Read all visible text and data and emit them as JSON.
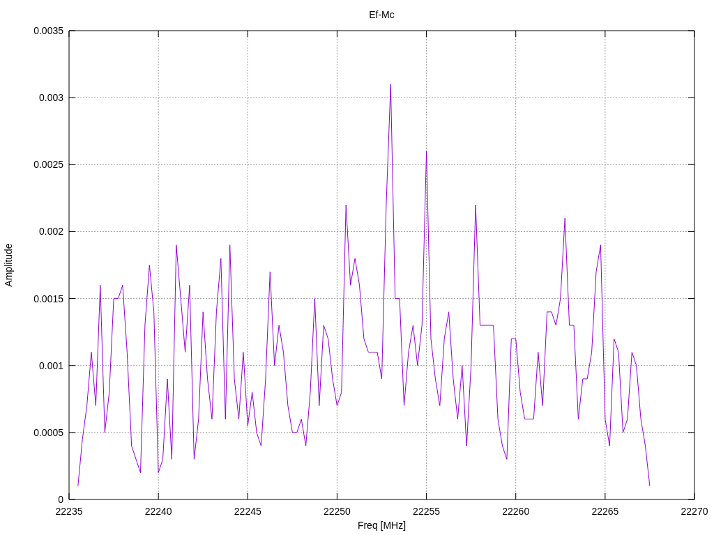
{
  "plot": {
    "chart_data": {
      "type": "line",
      "title": "Ef-Mc",
      "xlabel": "Freq [MHz]",
      "ylabel": "Amplitude",
      "x": [
        22235.5,
        22235.75,
        22236,
        22236.25,
        22236.5,
        22236.75,
        22237,
        22237.25,
        22237.5,
        22237.75,
        22238,
        22238.25,
        22238.5,
        22238.75,
        22239,
        22239.25,
        22239.5,
        22239.75,
        22240,
        22240.25,
        22240.5,
        22240.75,
        22241,
        22241.25,
        22241.5,
        22241.75,
        22242,
        22242.25,
        22242.5,
        22242.75,
        22243,
        22243.25,
        22243.5,
        22243.75,
        22244,
        22244.25,
        22244.5,
        22244.75,
        22245,
        22245.25,
        22245.5,
        22245.75,
        22246,
        22246.25,
        22246.5,
        22246.75,
        22247,
        22247.25,
        22247.5,
        22247.75,
        22248,
        22248.25,
        22248.5,
        22248.75,
        22249,
        22249.25,
        22249.5,
        22249.75,
        22250,
        22250.25,
        22250.5,
        22250.75,
        22251,
        22251.25,
        22251.5,
        22251.75,
        22252,
        22252.25,
        22252.5,
        22252.75,
        22253,
        22253.25,
        22253.5,
        22253.75,
        22254,
        22254.25,
        22254.5,
        22254.75,
        22255,
        22255.25,
        22255.5,
        22255.75,
        22256,
        22256.25,
        22256.5,
        22256.75,
        22257,
        22257.25,
        22257.5,
        22257.75,
        22258,
        22258.25,
        22258.5,
        22258.75,
        22259,
        22259.25,
        22259.5,
        22259.75,
        22260,
        22260.25,
        22260.5,
        22260.75,
        22261,
        22261.25,
        22261.5,
        22261.75,
        22262,
        22262.25,
        22262.5,
        22262.75,
        22263,
        22263.25,
        22263.5,
        22263.75,
        22264,
        22264.25,
        22264.5,
        22264.75,
        22265,
        22265.25,
        22265.5,
        22265.75,
        22266,
        22266.25,
        22266.5,
        22266.75,
        22267,
        22267.25,
        22267.5
      ],
      "series": [
        {
          "color": "#9400d3",
          "values": [
            0.0001,
            0.00045,
            0.0007,
            0.0011,
            0.0007,
            0.0016,
            0.0005,
            0.0008,
            0.0015,
            0.0015,
            0.0016,
            0.0011,
            0.0004,
            0.0003,
            0.0002,
            0.0013,
            0.00175,
            0.0014,
            0.0002,
            0.0003,
            0.0009,
            0.0003,
            0.0019,
            0.0015,
            0.0011,
            0.0016,
            0.0003,
            0.0006,
            0.0014,
            0.0009,
            0.0006,
            0.0014,
            0.0018,
            0.0006,
            0.0019,
            0.0009,
            0.0006,
            0.0011,
            0.00055,
            0.0008,
            0.0005,
            0.0004,
            0.0009,
            0.0017,
            0.001,
            0.0013,
            0.0011,
            0.0007,
            0.0005,
            0.0005,
            0.0006,
            0.0004,
            0.0008,
            0.0015,
            0.0007,
            0.0013,
            0.0012,
            0.0009,
            0.0007,
            0.0008,
            0.0022,
            0.0016,
            0.0018,
            0.0016,
            0.0012,
            0.0011,
            0.0011,
            0.0011,
            0.0009,
            0.0022,
            0.0031,
            0.0015,
            0.0015,
            0.0007,
            0.0011,
            0.0013,
            0.001,
            0.0013,
            0.0026,
            0.0012,
            0.0009,
            0.0007,
            0.0012,
            0.0014,
            0.0009,
            0.0006,
            0.001,
            0.0004,
            0.001,
            0.0022,
            0.0013,
            0.0013,
            0.0013,
            0.0013,
            0.0006,
            0.0004,
            0.0003,
            0.0012,
            0.0012,
            0.0008,
            0.0006,
            0.0006,
            0.0006,
            0.0011,
            0.0007,
            0.0014,
            0.0014,
            0.0013,
            0.0015,
            0.0021,
            0.0013,
            0.0013,
            0.0006,
            0.0009,
            0.0009,
            0.0011,
            0.0017,
            0.0019,
            0.0006,
            0.0004,
            0.0012,
            0.0011,
            0.0005,
            0.0006,
            0.0011,
            0.001,
            0.0006,
            0.0004,
            0.0001
          ]
        }
      ],
      "grid": true,
      "xlim": [
        22235,
        22270
      ],
      "ylim": [
        0,
        0.0035
      ],
      "xticks": [
        22235,
        22240,
        22245,
        22250,
        22255,
        22260,
        22265,
        22270
      ],
      "yticks": [
        0,
        0.0005,
        0.001,
        0.0015,
        0.002,
        0.0025,
        0.003,
        0.0035
      ]
    }
  }
}
